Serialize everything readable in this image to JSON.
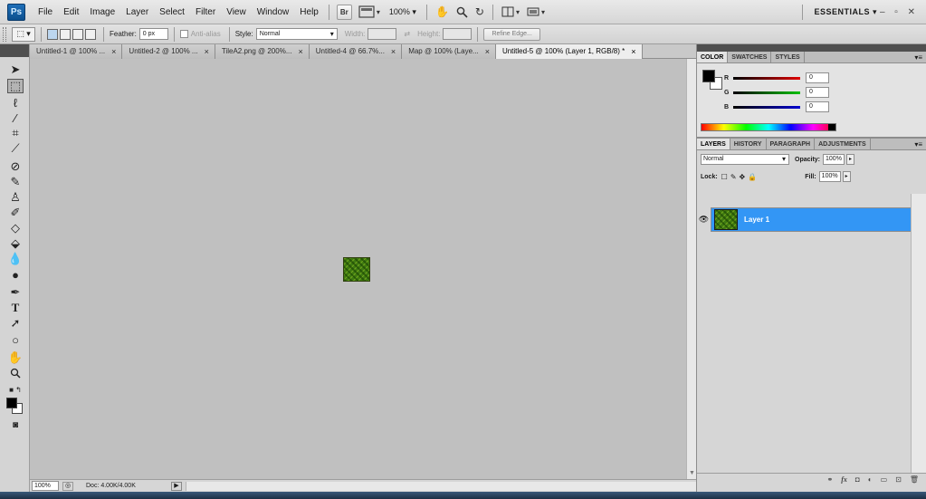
{
  "app": {
    "logo": "Ps"
  },
  "menu": [
    "File",
    "Edit",
    "Image",
    "Layer",
    "Select",
    "Filter",
    "View",
    "Window",
    "Help"
  ],
  "menubar_tools": {
    "bridge": "Br",
    "zoom": "100%",
    "workspace": "ESSENTIALS",
    "window_controls": "– ▫ ✕"
  },
  "options": {
    "feather_label": "Feather:",
    "feather_value": "0 px",
    "antialias_label": "Anti-alias",
    "style_label": "Style:",
    "style_value": "Normal",
    "width_label": "Width:",
    "height_label": "Height:",
    "refine_edge": "Refine Edge..."
  },
  "tabs": [
    {
      "label": "Untitled-1 @ 100% ...",
      "active": false
    },
    {
      "label": "Untitled-2 @ 100% ...",
      "active": false
    },
    {
      "label": "TileA2.png @ 200%...",
      "active": false
    },
    {
      "label": "Untitled-4 @ 66.7%...",
      "active": false
    },
    {
      "label": "Map @ 100% (Laye...",
      "active": false
    },
    {
      "label": "Untitled-5 @ 100% (Layer 1, RGB/8) *",
      "active": true
    }
  ],
  "status": {
    "zoom": "100%",
    "doc": "Doc: 4.00K/4.00K"
  },
  "color_panel": {
    "tabs": [
      "COLOR",
      "SWATCHES",
      "STYLES"
    ],
    "sliders": [
      {
        "label": "R",
        "value": "0",
        "color": "#e00000"
      },
      {
        "label": "G",
        "value": "0",
        "color": "#00c000"
      },
      {
        "label": "B",
        "value": "0",
        "color": "#0000d0"
      }
    ],
    "foreground": "#000000",
    "background": "#ffffff"
  },
  "layers_panel": {
    "tabs": [
      "LAYERS",
      "HISTORY",
      "PARAGRAPH",
      "ADJUSTMENTS"
    ],
    "blend_mode": "Normal",
    "opacity_label": "Opacity:",
    "opacity_value": "100%",
    "lock_label": "Lock:",
    "fill_label": "Fill:",
    "fill_value": "100%",
    "layers": [
      {
        "name": "Layer 1",
        "selected": true,
        "visible": true
      }
    ]
  },
  "colors": {
    "selection_blue": "#3396f5",
    "chrome": "#d6d6d6",
    "canvas_bg": "#c0c0c0",
    "tile_green": "#3f7a11"
  },
  "icons": [
    "move-icon",
    "marquee-icon",
    "lasso-icon",
    "magic-wand-icon",
    "crop-icon",
    "eyedropper-icon",
    "healing-icon",
    "brush-icon",
    "stamp-icon",
    "history-brush-icon",
    "eraser-icon",
    "bucket-icon",
    "blur-icon",
    "dodge-icon",
    "pen-icon",
    "type-icon",
    "path-select-icon",
    "shape-icon",
    "hand-icon",
    "zoom-icon",
    "quick-mask-icon"
  ]
}
